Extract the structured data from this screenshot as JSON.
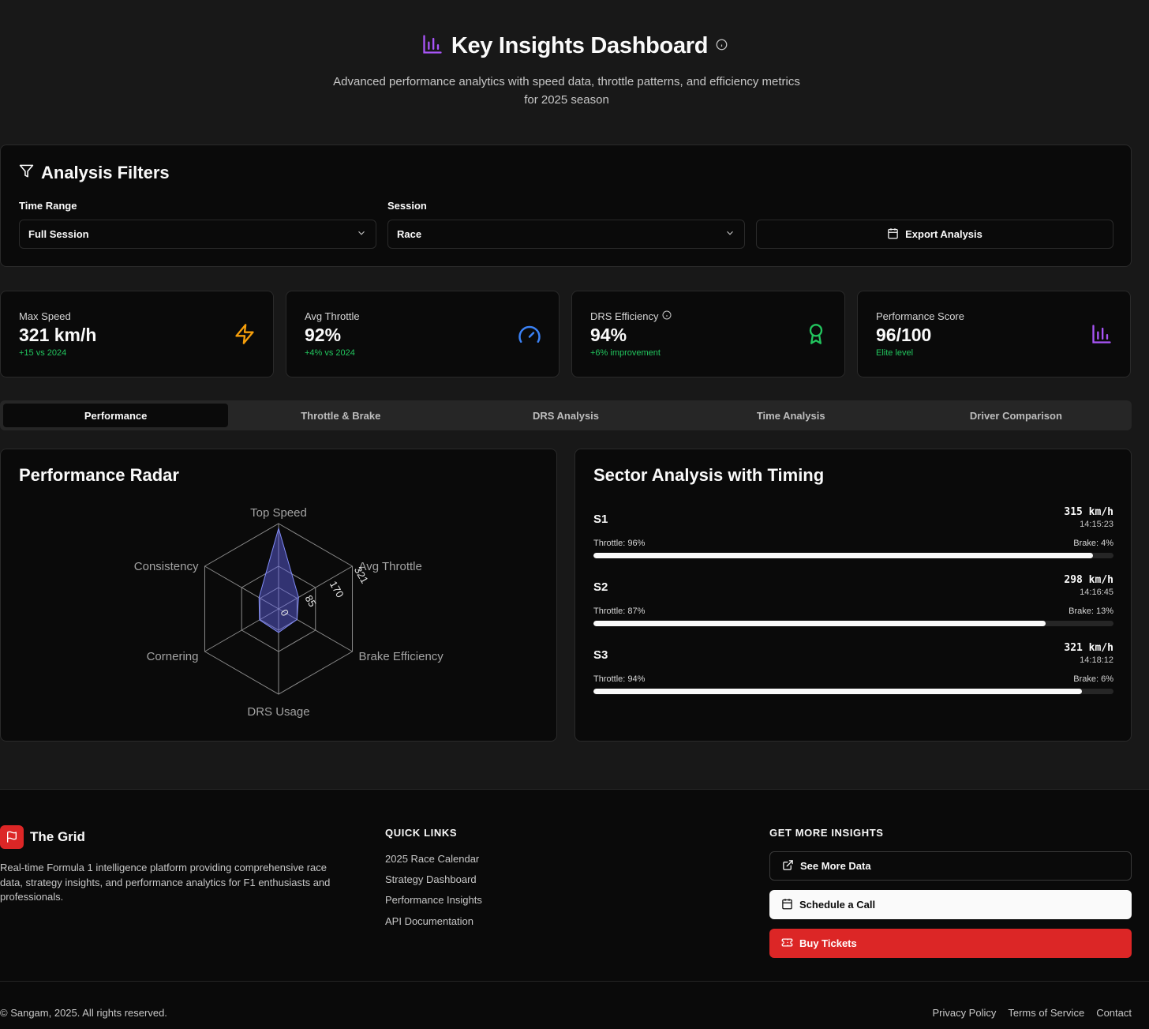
{
  "header": {
    "title": "Key Insights Dashboard",
    "subtitle": "Advanced performance analytics with speed data, throttle patterns, and efficiency metrics for 2025 season"
  },
  "filters": {
    "title": "Analysis Filters",
    "time_range_label": "Time Range",
    "time_range_value": "Full Session",
    "session_label": "Session",
    "session_value": "Race",
    "export_label": "Export Analysis"
  },
  "stats": [
    {
      "label": "Max Speed",
      "value": "321 km/h",
      "delta": "+15 vs 2024",
      "icon": "lightning-icon",
      "icon_color": "#f59e0b"
    },
    {
      "label": "Avg Throttle",
      "value": "92%",
      "delta": "+4% vs 2024",
      "icon": "gauge-icon",
      "icon_color": "#3b82f6"
    },
    {
      "label": "DRS Efficiency",
      "value": "94%",
      "delta": "+6% improvement",
      "icon": "award-icon",
      "icon_color": "#22c55e"
    },
    {
      "label": "Performance Score",
      "value": "96/100",
      "delta": "Elite level",
      "icon": "bar-chart-icon",
      "icon_color": "#a855f7"
    }
  ],
  "tabs": [
    "Performance",
    "Throttle & Brake",
    "DRS Analysis",
    "Time Analysis",
    "Driver Comparison"
  ],
  "active_tab": "Performance",
  "radar": {
    "title": "Performance Radar",
    "axes": [
      "Top Speed",
      "Avg Throttle",
      "Brake Efficiency",
      "DRS Usage",
      "Cornering",
      "Consistency"
    ],
    "ticks": [
      "0",
      "85",
      "170",
      "321"
    ],
    "max": 340,
    "values": [
      321,
      92,
      85,
      94,
      88,
      90
    ]
  },
  "sectors": {
    "title": "Sector Analysis with Timing",
    "items": [
      {
        "name": "S1",
        "speed": "315 km/h",
        "time": "14:15:23",
        "throttle": "Throttle: 96%",
        "brake": "Brake: 4%",
        "throttle_pct": 96
      },
      {
        "name": "S2",
        "speed": "298 km/h",
        "time": "14:16:45",
        "throttle": "Throttle: 87%",
        "brake": "Brake: 13%",
        "throttle_pct": 87
      },
      {
        "name": "S3",
        "speed": "321 km/h",
        "time": "14:18:12",
        "throttle": "Throttle: 94%",
        "brake": "Brake: 6%",
        "throttle_pct": 94
      }
    ]
  },
  "footer": {
    "brand": "The Grid",
    "description": "Real-time Formula 1 intelligence platform providing comprehensive race data, strategy insights, and performance analytics for F1 enthusiasts and professionals.",
    "quick_links_title": "QUICK LINKS",
    "quick_links": [
      "2025 Race Calendar",
      "Strategy Dashboard",
      "Performance Insights",
      "API Documentation"
    ],
    "insights_title": "GET MORE INSIGHTS",
    "see_more": "See More Data",
    "schedule": "Schedule a Call",
    "tickets": "Buy Tickets",
    "copyright": "© Sangam, 2025. All rights reserved.",
    "legal": [
      "Privacy Policy",
      "Terms of Service",
      "Contact"
    ]
  },
  "colors": {
    "accent": "#a855f7",
    "brand_red": "#dc2626",
    "positive": "#22c55e"
  }
}
